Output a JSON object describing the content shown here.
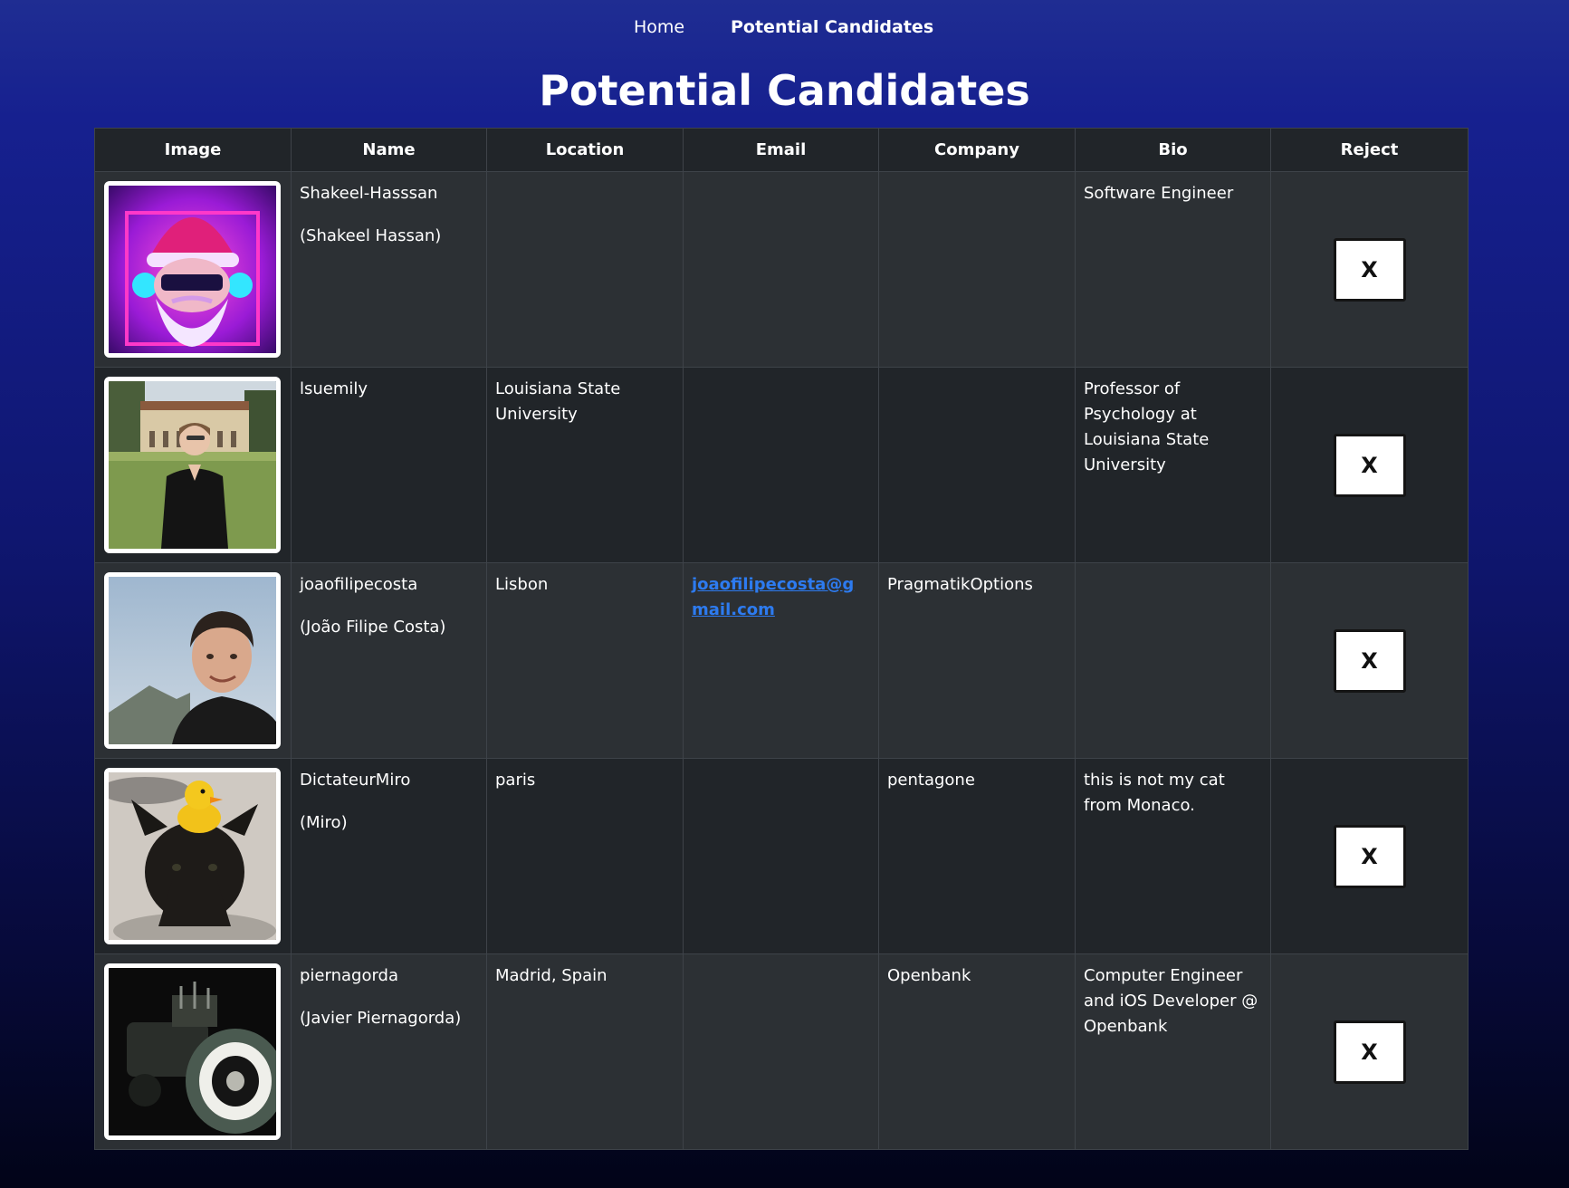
{
  "nav": {
    "home_label": "Home",
    "active_label": "Potential Candidates"
  },
  "page_title": "Potential Candidates",
  "table": {
    "headers": [
      "Image",
      "Name",
      "Location",
      "Email",
      "Company",
      "Bio",
      "Reject"
    ],
    "reject_label": "X",
    "rows": [
      {
        "login": "Shakeel-Hasssan",
        "full_name": "(Shakeel Hassan)",
        "location": "",
        "email": "",
        "company": "",
        "bio": "Software Engineer",
        "avatar_icon": "santa-dj-avatar"
      },
      {
        "login": "lsuemily",
        "full_name": "",
        "location": "Louisiana State University",
        "email": "",
        "company": "",
        "bio": "Professor of Psychology at Louisiana State University",
        "avatar_icon": "campus-portrait-avatar"
      },
      {
        "login": "joaofilipecosta",
        "full_name": "(João Filipe Costa)",
        "location": "Lisbon",
        "email": "joaofilipecosta@gmail.com",
        "company": "PragmatikOptions",
        "bio": "",
        "avatar_icon": "man-portrait-avatar"
      },
      {
        "login": "DictateurMiro",
        "full_name": "(Miro)",
        "location": "paris",
        "email": "",
        "company": "pentagone",
        "bio": "this is not my cat from Monaco.",
        "avatar_icon": "cat-with-duck-avatar"
      },
      {
        "login": "piernagorda",
        "full_name": "(Javier Piernagorda)",
        "location": "Madrid, Spain",
        "email": "",
        "company": "Openbank",
        "bio": "Computer Engineer and iOS Developer @ Openbank",
        "avatar_icon": "hotrod-wheel-avatar"
      }
    ]
  }
}
